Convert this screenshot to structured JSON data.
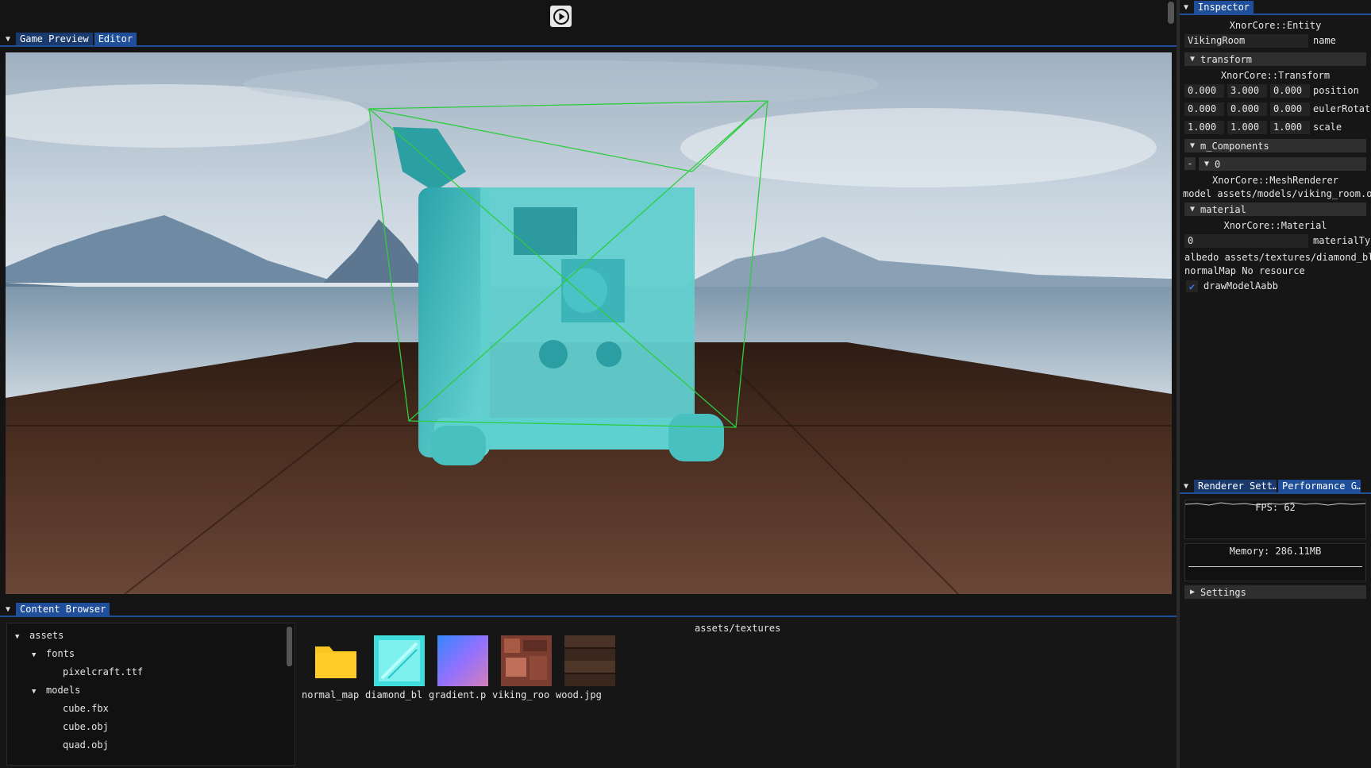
{
  "toolbar": {
    "play_icon": "play-circle-icon"
  },
  "viewport_tabs": [
    {
      "label": "Game Preview"
    },
    {
      "label": "Editor"
    }
  ],
  "content_browser": {
    "tab_label": "Content Browser",
    "tree": [
      {
        "label": "assets",
        "expanded": true
      },
      {
        "label": "fonts",
        "expanded": true
      },
      {
        "label": "pixelcraft.ttf"
      },
      {
        "label": "models",
        "expanded": true
      },
      {
        "label": "cube.fbx"
      },
      {
        "label": "cube.obj"
      },
      {
        "label": "quad.obj"
      }
    ],
    "path": "assets/textures",
    "files": [
      {
        "name": "normal_map",
        "icon": "folder-icon"
      },
      {
        "name": "diamond_bl",
        "icon": "diamond-texture-thumbnail"
      },
      {
        "name": "gradient.p",
        "icon": "gradient-texture-thumbnail"
      },
      {
        "name": "viking_roo",
        "icon": "viking-room-texture-thumbnail"
      },
      {
        "name": "wood.jpg",
        "icon": "wood-texture-thumbnail"
      }
    ]
  },
  "inspector": {
    "tab_label": "Inspector",
    "entity_type": "XnorCore::Entity",
    "name_value": "VikingRoom",
    "name_label": "name",
    "transform_header": "transform",
    "transform_type": "XnorCore::Transform",
    "position": [
      "0.000",
      "3.000",
      "0.000"
    ],
    "position_label": "position",
    "euler": [
      "0.000",
      "0.000",
      "0.000"
    ],
    "euler_label": "eulerRotat",
    "scale": [
      "1.000",
      "1.000",
      "1.000"
    ],
    "scale_label": "scale",
    "components_header": "m_Components",
    "component_index": "0",
    "remove_label": "-",
    "mesh_renderer_type": "XnorCore::MeshRenderer",
    "model_row": "model assets/models/viking_room.o",
    "material_header": "material",
    "material_type": "XnorCore::Material",
    "material_type_value": "0",
    "material_type_label": "materialTy",
    "albedo_row": "albedo assets/textures/diamond_bl",
    "normal_row": "normalMap No resource",
    "draw_aabb_label": "drawModelAabb",
    "draw_aabb_checked": true
  },
  "perf": {
    "tabs": [
      {
        "label": "Renderer Sett…"
      },
      {
        "label": "Performance G…"
      }
    ],
    "fps_text": "FPS: 62",
    "memory_text": "Memory: 286.11MB",
    "settings_label": "Settings"
  },
  "colors": {
    "accent": "#1f4f9a",
    "aabb": "#2ecc40",
    "mesh": "#3fc8c8"
  }
}
